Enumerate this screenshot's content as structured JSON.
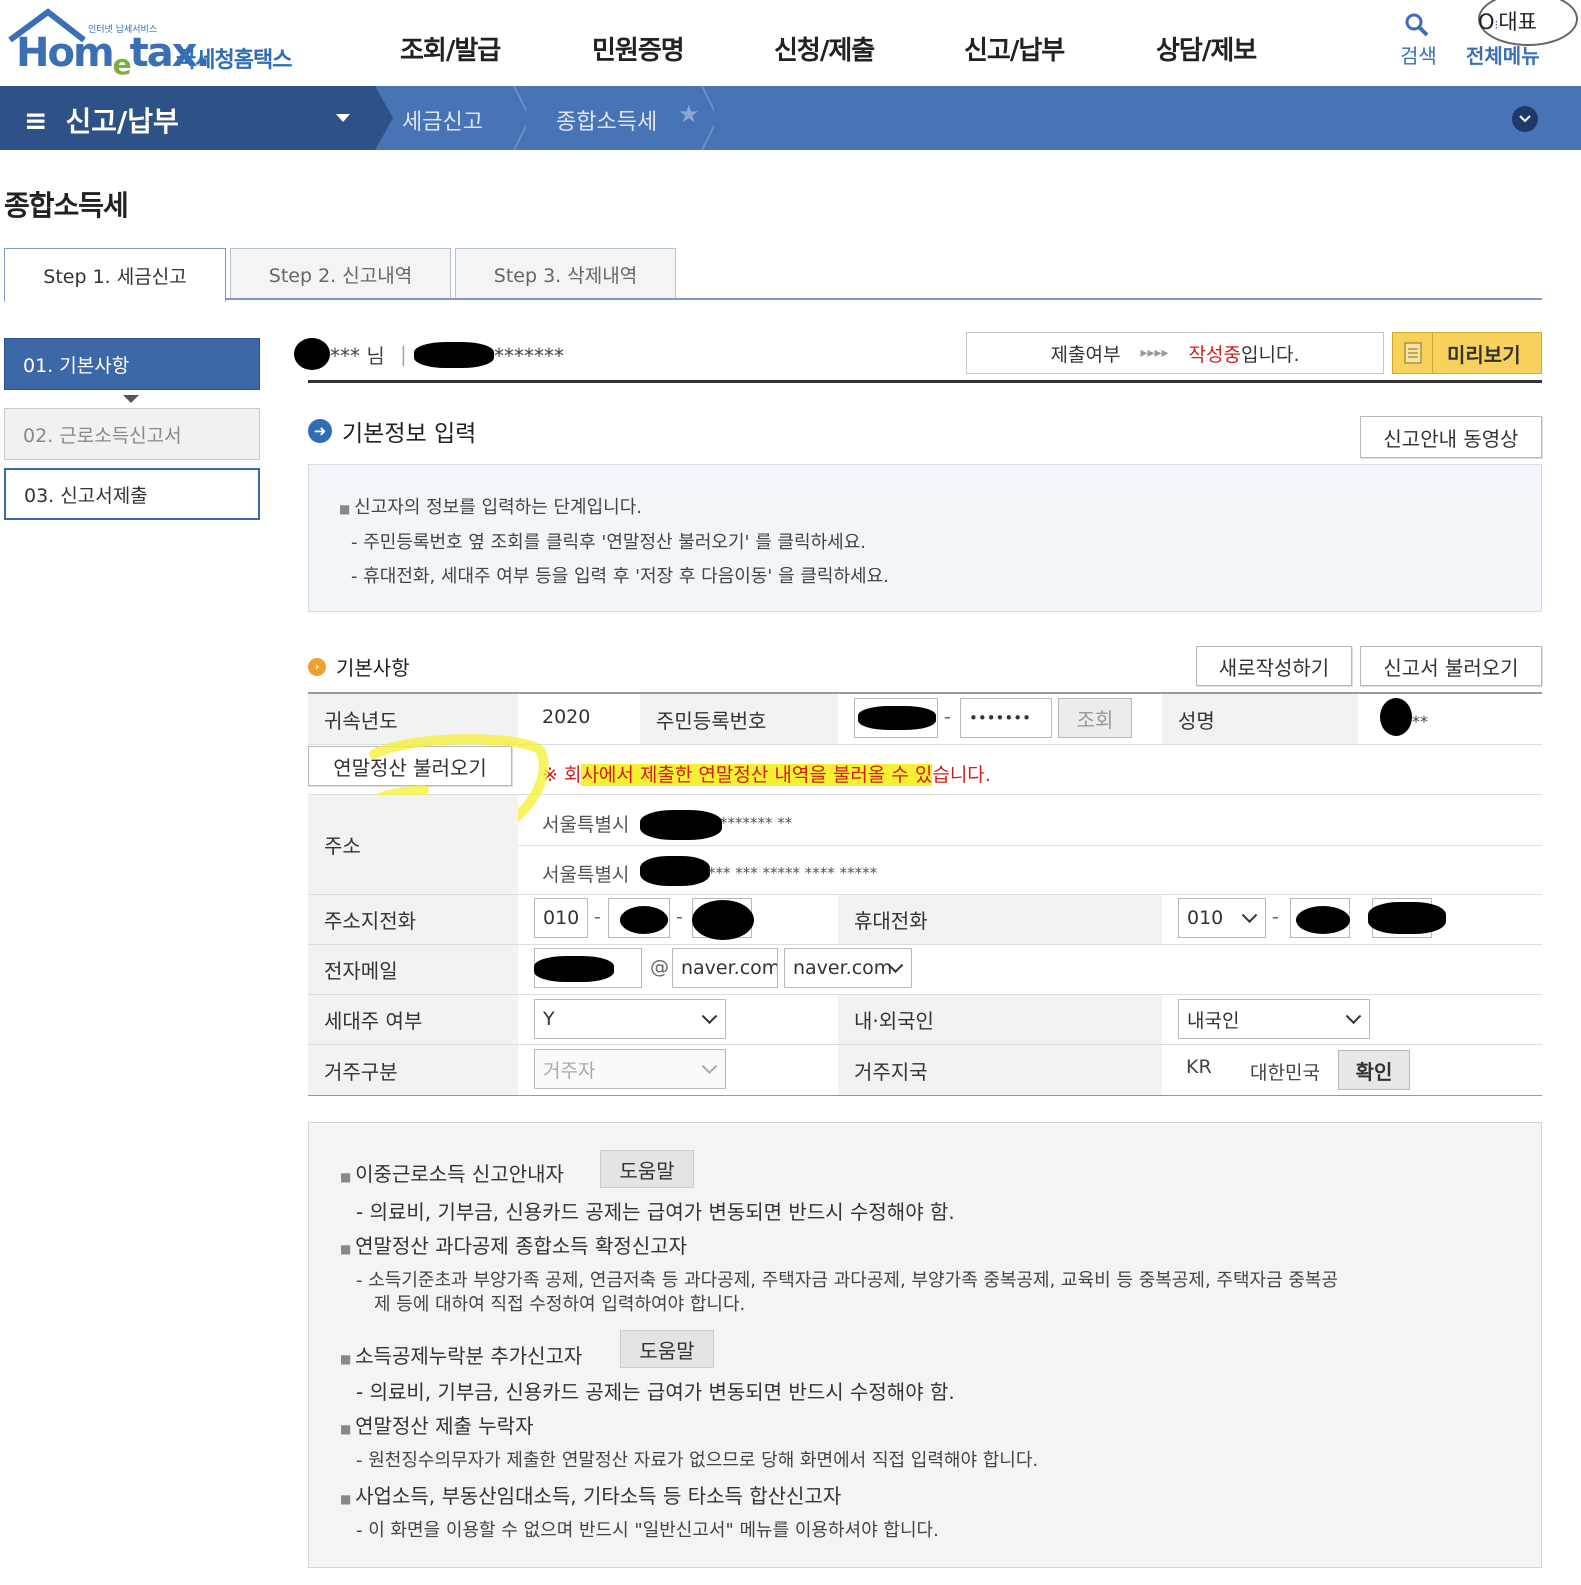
{
  "header": {
    "logo_tag": "인터넷 납세서비스",
    "logo_word": "Hometax",
    "logo_kr": "국세청홈택스",
    "nav": [
      "조회/발급",
      "민원증명",
      "신청/제출",
      "신고/납부",
      "상담/제보"
    ],
    "search_label": "검색",
    "allmenu_label": "전체메뉴",
    "rep_label": "대표"
  },
  "navbar": {
    "section": "신고/납부",
    "crumbs": [
      "세금신고",
      "종합소득세"
    ]
  },
  "page_title": "종합소득세",
  "tabs": [
    "Step 1. 세금신고",
    "Step 2. 신고내역",
    "Step 3. 삭제내역"
  ],
  "side": [
    "01. 기본사항",
    "02. 근로소득신고서",
    "03. 신고서제출"
  ],
  "user": {
    "name_suffix": "*** 님",
    "sep": "|",
    "id_masked": "*******"
  },
  "status": {
    "label": "제출여부",
    "arrows": "▸▸▸▸",
    "state": "작성중",
    "tail": "입니다."
  },
  "preview_label": "미리보기",
  "section1": {
    "title": "기본정보 입력",
    "video_btn": "신고안내 동영상",
    "info": [
      "신고자의 정보를 입력하는 단계입니다.",
      "- 주민등록번호 옆 조회를 클릭후 '연말정산 불러오기' 를 클릭하세요.",
      "- 휴대전화, 세대주 여부 등을 입력 후 '저장 후 다음이동' 을 클릭하세요."
    ]
  },
  "section2": {
    "title": "기본사항",
    "new_btn": "새로작성하기",
    "load_btn": "신고서 불러오기"
  },
  "form": {
    "year_label": "귀속년도",
    "year": "2020",
    "rrn_label": "주민등록번호",
    "rrn_back": "•••••••",
    "lookup_btn": "조회",
    "name_label": "성명",
    "name_masked": "**",
    "yearend_btn": "연말정산 불러오기",
    "notice_mark": "※ 회",
    "notice_highlight": "사에서 제출한 연말정산 내역을 불러올 수 있",
    "notice_tail": "습니다.",
    "address_label": "주소",
    "address1_city": "서울특별시",
    "address1_masked": "******* **",
    "address2_city": "서울특별시",
    "address2_masked": "*** *** ***** **** *****",
    "homephone_label": "주소지전화",
    "homephone_prefix": "010",
    "mobile_label": "휴대전화",
    "mobile_prefix": "010",
    "email_label": "전자메일",
    "email_at": "@",
    "email_domain": "naver.com",
    "email_domain_select": "naver.com",
    "householder_label": "세대주 여부",
    "householder_value": "Y",
    "nationality_label": "내·외국인",
    "nationality_value": "내국인",
    "residence_label": "거주구분",
    "residence_value": "거주자",
    "country_label": "거주지국",
    "country_code": "KR",
    "country_name": "대한민국",
    "confirm_btn": "확인"
  },
  "help": [
    {
      "title": "이중근로소득 신고안내자",
      "button": "도움말",
      "desc": [
        "- 의료비, 기부금, 신용카드 공제는 급여가 변동되면 반드시 수정해야 함."
      ]
    },
    {
      "title": "연말정산 과다공제 종합소득 확정신고자",
      "button": "",
      "desc": [
        "- 소득기준초과 부양가족 공제, 연금저축 등 과다공제, 주택자금 과다공제, 부양가족 중복공제, 교육비 등 중복공제, 주택자금 중복공",
        "제 등에 대하여 직접 수정하여 입력하여야 합니다."
      ]
    },
    {
      "title": "소득공제누락분 추가신고자",
      "button": "도움말",
      "desc": [
        "- 의료비, 기부금, 신용카드 공제는 급여가 변동되면 반드시 수정해야 함."
      ]
    },
    {
      "title": "연말정산 제출 누락자",
      "button": "",
      "desc": [
        "- 원천징수의무자가 제출한 연말정산 자료가 없으므로 당해 화면에서 직접 입력해야 합니다."
      ]
    },
    {
      "title": "사업소득, 부동산임대소득, 기타소득 등 타소득 합산신고자",
      "button": "",
      "desc": [
        "- 이 화면을 이용할 수 없으며 반드시 \"일반신고서\" 메뉴를 이용하셔야 합니다."
      ]
    }
  ],
  "colors": {
    "nav_blue": "#4873b5",
    "nav_dark": "#2e5187",
    "status_red": "#d21e1e",
    "annotation_yellow": "#f6f032",
    "preview_yellow": "#f7d15c"
  }
}
